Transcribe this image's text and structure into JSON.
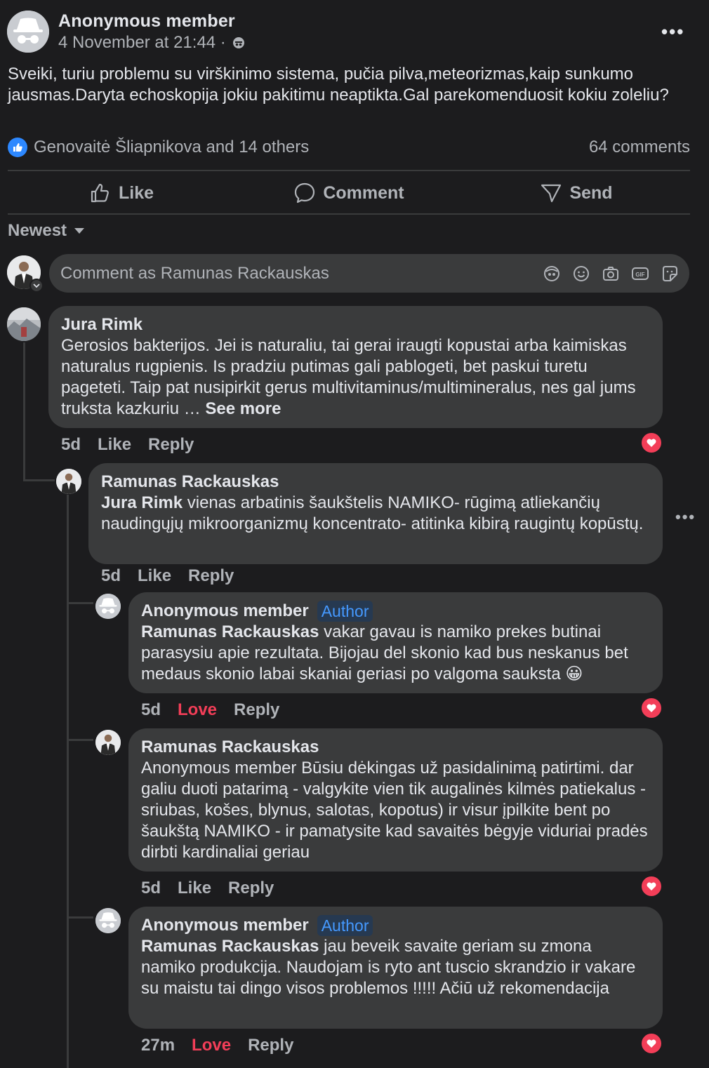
{
  "post": {
    "author": "Anonymous member",
    "timestamp": "4 November at 21:44 ·",
    "menu": "•••",
    "text": "Sveiki, turiu problemu su virškinimo sistema, pučia pilva,meteorizmas,kaip sunkumo jausmas.Daryta echoskopija jokiu pakitimu neaptikta.Gal parekomenduosit kokiu zoleliu?",
    "reactions_text": "Genovaitė Šliapnikova and 14 others",
    "comments_count": "64 comments"
  },
  "actions": {
    "like": "Like",
    "comment": "Comment",
    "send": "Send"
  },
  "sort": {
    "label": "Newest"
  },
  "composer": {
    "placeholder": "Comment as Ramunas Rackauskas"
  },
  "comments": [
    {
      "author": "Jura Rimk",
      "text": "Gerosios bakterijos. Jei is naturaliu, tai gerai iraugti kopustai arba kaimiskas naturalus rugpienis. Is pradziu putimas gali pablogeti, bet paskui turetu pageteti. Taip pat nusipirkit gerus multivitaminus/multimineralus, nes gal jums truksta kazkuriu …",
      "see_more": "See more",
      "time": "5d",
      "reaction": "Like",
      "reply": "Reply"
    },
    {
      "author": "Ramunas Rackauskas",
      "mention": "Jura Rimk",
      "text": " vienas arbatinis šaukštelis NAMIKO- rūgimą atliekančių naudingųjų mikroorganizmų koncentrato- atitinka kibirą raugintų kopūstų.",
      "time": "5d",
      "reaction": "Like",
      "reply": "Reply",
      "menu": "•••"
    },
    {
      "author": "Anonymous member",
      "badge": "Author",
      "mention": "Ramunas Rackauskas",
      "text": " vakar gavau is namiko prekes butinai parasysiu apie rezultata. Bijojau del skonio kad bus neskanus bet medaus skonio labai skaniai geriasi po valgoma sauksta",
      "emoji": "😀",
      "time": "5d",
      "reaction": "Love",
      "reply": "Reply"
    },
    {
      "author": "Ramunas Rackauskas",
      "text": "Anonymous member Būsiu dėkingas už pasidalinimą patirtimi. dar galiu duoti patarimą - valgykite vien tik augalinės kilmės patiekalus - sriubas, košes, blynus, salotas, kopotus) ir visur įpilkite bent po šaukštą NAMIKO - ir pamatysite kad savaitės bėgyje viduriai pradės dirbti kardinaliai geriau",
      "time": "5d",
      "reaction": "Like",
      "reply": "Reply"
    },
    {
      "author": "Anonymous member",
      "badge": "Author",
      "mention": "Ramunas Rackauskas",
      "text": " jau beveik savaite geriam su zmona namiko produkcija. Naudojam is ryto ant tuscio skrandzio ir vakare su maistu tai dingo visos problemos !!!!! Ačiū už rekomendacija",
      "time": "27m",
      "reaction": "Love",
      "reply": "Reply"
    }
  ],
  "colors": {
    "background": "#1c1c1e",
    "bubble": "#3a3b3c",
    "text": "#e4e6eb",
    "muted": "#b0b3b8",
    "love": "#f33e58",
    "link_blue": "#4599ff",
    "like_blue": "#2d88ff"
  },
  "icons": [
    "incognito-avatar-icon",
    "globe-privacy-icon",
    "like-thumb-icon",
    "comment-bubble-icon",
    "send-icon",
    "dropdown-caret-icon",
    "avatar-sticker-icon",
    "emoji-icon",
    "camera-icon",
    "gif-icon",
    "sticker-icon",
    "heart-reaction-icon"
  ]
}
